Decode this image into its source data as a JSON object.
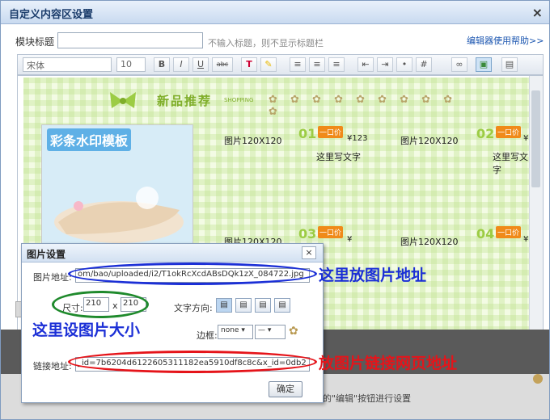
{
  "dialog": {
    "title": "自定义内容区设置",
    "close_glyph": "×",
    "module_title_label": "模块标题",
    "module_title_value": "",
    "module_title_hint": "不输入标题，则不显示标题栏",
    "help_link": "编辑器使用帮助>>",
    "footer_hint": "的\"编辑\"按钮进行设置"
  },
  "toolbar": {
    "font": "宋体",
    "size": "10",
    "bold": "B",
    "italic": "I",
    "underline": "U",
    "strike": "abc"
  },
  "content": {
    "banner_title": "新品推荐",
    "banner_sub": "SHOPPING",
    "promo_text": "彩条水印模板",
    "products": [
      {
        "img_label": "图片120X120",
        "num": "01",
        "badge": "一口价",
        "price": "¥123",
        "desc": "这里写文字"
      },
      {
        "img_label": "图片120X120",
        "num": "02",
        "badge": "一口价",
        "price": "¥",
        "desc": "这里写文字"
      },
      {
        "img_label": "图片120X120",
        "num": "03",
        "badge": "一口价",
        "price": "¥",
        "desc": ""
      },
      {
        "img_label": "图片120X120",
        "num": "04",
        "badge": "一口价",
        "price": "¥",
        "desc": ""
      }
    ]
  },
  "image_dialog": {
    "title": "图片设置",
    "close_glyph": "×",
    "url_label": "图片地址:",
    "url_value": "om/bao/uploaded/i2/T1okRcXcdABsDQk1zX_084722.jpg",
    "size_label": "尺寸:",
    "width": "210",
    "times": "x",
    "height": "210",
    "text_dir_label": "文字方向:",
    "border_label": "边框:",
    "border_style": "none",
    "link_label": "链接地址:",
    "link_value": "_id=7b6204d6122605311182ea5910df8c8c&x_id=0db2",
    "ok": "确定"
  },
  "annotations": {
    "url_note": "这里放图片地址",
    "size_note": "这里设图片大小",
    "link_note": "放图片链接网页地址",
    "colors": {
      "blue": "#1b2fd6",
      "green": "#1f8a2c",
      "red": "#e5141a"
    }
  }
}
